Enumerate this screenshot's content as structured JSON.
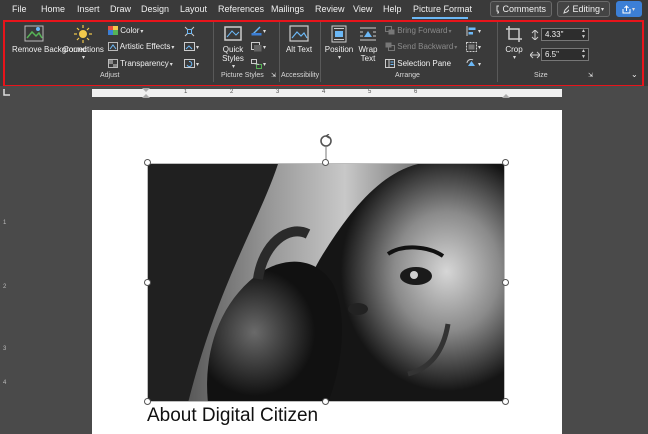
{
  "menu": {
    "tabs": [
      "File",
      "Home",
      "Insert",
      "Draw",
      "Design",
      "Layout",
      "References",
      "Mailings",
      "Review",
      "View",
      "Help",
      "Picture Format"
    ],
    "active_tab": "Picture Format",
    "comments_label": "Comments",
    "editing_label": "Editing"
  },
  "ribbon": {
    "adjust": {
      "label": "Adjust",
      "remove_background": "Remove Background",
      "corrections": "Corrections",
      "color": "Color",
      "artistic_effects": "Artistic Effects",
      "transparency": "Transparency"
    },
    "picture_styles": {
      "label": "Picture Styles",
      "quick_styles": "Quick Styles"
    },
    "accessibility": {
      "label": "Accessibility",
      "alt_text": "Alt Text"
    },
    "arrange": {
      "label": "Arrange",
      "position": "Position",
      "wrap_text": "Wrap Text",
      "bring_forward": "Bring Forward",
      "send_backward": "Send Backward",
      "selection_pane": "Selection Pane"
    },
    "size": {
      "label": "Size",
      "crop": "Crop",
      "height": "4.33\"",
      "width": "6.5\""
    }
  },
  "ruler": {
    "horizontal_numbers": [
      "1",
      "2",
      "3",
      "4",
      "5",
      "6"
    ],
    "vertical_numbers": [
      "1",
      "2",
      "3",
      "4"
    ]
  },
  "document": {
    "heading": "About Digital Citizen"
  },
  "colors": {
    "accent": "#6cb8f6",
    "highlight": "#e8141b",
    "ribbon_bg": "#3a3a3a",
    "share_bg": "#3c7fd6"
  }
}
